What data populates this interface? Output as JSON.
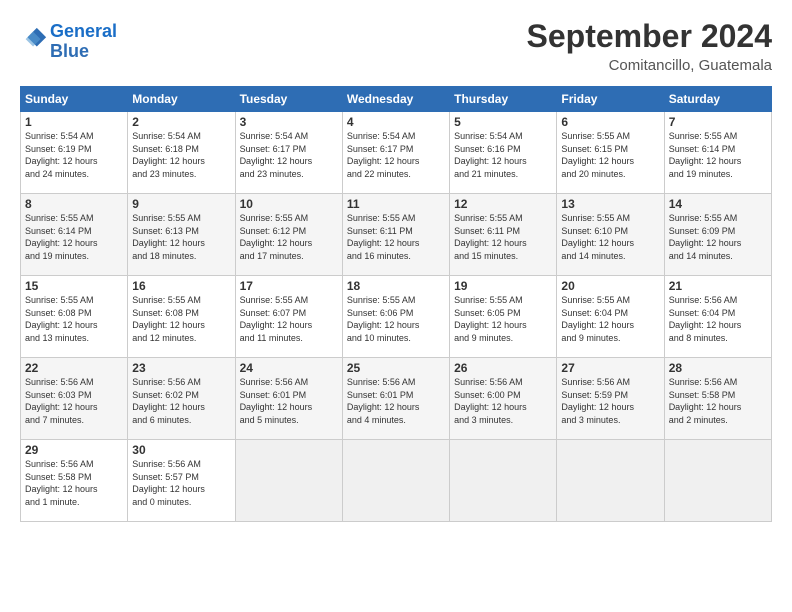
{
  "header": {
    "logo_line1": "General",
    "logo_line2": "Blue",
    "month_year": "September 2024",
    "location": "Comitancillo, Guatemala"
  },
  "days_of_week": [
    "Sunday",
    "Monday",
    "Tuesday",
    "Wednesday",
    "Thursday",
    "Friday",
    "Saturday"
  ],
  "weeks": [
    [
      {
        "day": "1",
        "info": "Sunrise: 5:54 AM\nSunset: 6:19 PM\nDaylight: 12 hours\nand 24 minutes."
      },
      {
        "day": "2",
        "info": "Sunrise: 5:54 AM\nSunset: 6:18 PM\nDaylight: 12 hours\nand 23 minutes."
      },
      {
        "day": "3",
        "info": "Sunrise: 5:54 AM\nSunset: 6:17 PM\nDaylight: 12 hours\nand 23 minutes."
      },
      {
        "day": "4",
        "info": "Sunrise: 5:54 AM\nSunset: 6:17 PM\nDaylight: 12 hours\nand 22 minutes."
      },
      {
        "day": "5",
        "info": "Sunrise: 5:54 AM\nSunset: 6:16 PM\nDaylight: 12 hours\nand 21 minutes."
      },
      {
        "day": "6",
        "info": "Sunrise: 5:55 AM\nSunset: 6:15 PM\nDaylight: 12 hours\nand 20 minutes."
      },
      {
        "day": "7",
        "info": "Sunrise: 5:55 AM\nSunset: 6:14 PM\nDaylight: 12 hours\nand 19 minutes."
      }
    ],
    [
      {
        "day": "8",
        "info": "Sunrise: 5:55 AM\nSunset: 6:14 PM\nDaylight: 12 hours\nand 19 minutes."
      },
      {
        "day": "9",
        "info": "Sunrise: 5:55 AM\nSunset: 6:13 PM\nDaylight: 12 hours\nand 18 minutes."
      },
      {
        "day": "10",
        "info": "Sunrise: 5:55 AM\nSunset: 6:12 PM\nDaylight: 12 hours\nand 17 minutes."
      },
      {
        "day": "11",
        "info": "Sunrise: 5:55 AM\nSunset: 6:11 PM\nDaylight: 12 hours\nand 16 minutes."
      },
      {
        "day": "12",
        "info": "Sunrise: 5:55 AM\nSunset: 6:11 PM\nDaylight: 12 hours\nand 15 minutes."
      },
      {
        "day": "13",
        "info": "Sunrise: 5:55 AM\nSunset: 6:10 PM\nDaylight: 12 hours\nand 14 minutes."
      },
      {
        "day": "14",
        "info": "Sunrise: 5:55 AM\nSunset: 6:09 PM\nDaylight: 12 hours\nand 14 minutes."
      }
    ],
    [
      {
        "day": "15",
        "info": "Sunrise: 5:55 AM\nSunset: 6:08 PM\nDaylight: 12 hours\nand 13 minutes."
      },
      {
        "day": "16",
        "info": "Sunrise: 5:55 AM\nSunset: 6:08 PM\nDaylight: 12 hours\nand 12 minutes."
      },
      {
        "day": "17",
        "info": "Sunrise: 5:55 AM\nSunset: 6:07 PM\nDaylight: 12 hours\nand 11 minutes."
      },
      {
        "day": "18",
        "info": "Sunrise: 5:55 AM\nSunset: 6:06 PM\nDaylight: 12 hours\nand 10 minutes."
      },
      {
        "day": "19",
        "info": "Sunrise: 5:55 AM\nSunset: 6:05 PM\nDaylight: 12 hours\nand 9 minutes."
      },
      {
        "day": "20",
        "info": "Sunrise: 5:55 AM\nSunset: 6:04 PM\nDaylight: 12 hours\nand 9 minutes."
      },
      {
        "day": "21",
        "info": "Sunrise: 5:56 AM\nSunset: 6:04 PM\nDaylight: 12 hours\nand 8 minutes."
      }
    ],
    [
      {
        "day": "22",
        "info": "Sunrise: 5:56 AM\nSunset: 6:03 PM\nDaylight: 12 hours\nand 7 minutes."
      },
      {
        "day": "23",
        "info": "Sunrise: 5:56 AM\nSunset: 6:02 PM\nDaylight: 12 hours\nand 6 minutes."
      },
      {
        "day": "24",
        "info": "Sunrise: 5:56 AM\nSunset: 6:01 PM\nDaylight: 12 hours\nand 5 minutes."
      },
      {
        "day": "25",
        "info": "Sunrise: 5:56 AM\nSunset: 6:01 PM\nDaylight: 12 hours\nand 4 minutes."
      },
      {
        "day": "26",
        "info": "Sunrise: 5:56 AM\nSunset: 6:00 PM\nDaylight: 12 hours\nand 3 minutes."
      },
      {
        "day": "27",
        "info": "Sunrise: 5:56 AM\nSunset: 5:59 PM\nDaylight: 12 hours\nand 3 minutes."
      },
      {
        "day": "28",
        "info": "Sunrise: 5:56 AM\nSunset: 5:58 PM\nDaylight: 12 hours\nand 2 minutes."
      }
    ],
    [
      {
        "day": "29",
        "info": "Sunrise: 5:56 AM\nSunset: 5:58 PM\nDaylight: 12 hours\nand 1 minute."
      },
      {
        "day": "30",
        "info": "Sunrise: 5:56 AM\nSunset: 5:57 PM\nDaylight: 12 hours\nand 0 minutes."
      },
      {
        "day": "",
        "info": ""
      },
      {
        "day": "",
        "info": ""
      },
      {
        "day": "",
        "info": ""
      },
      {
        "day": "",
        "info": ""
      },
      {
        "day": "",
        "info": ""
      }
    ]
  ]
}
